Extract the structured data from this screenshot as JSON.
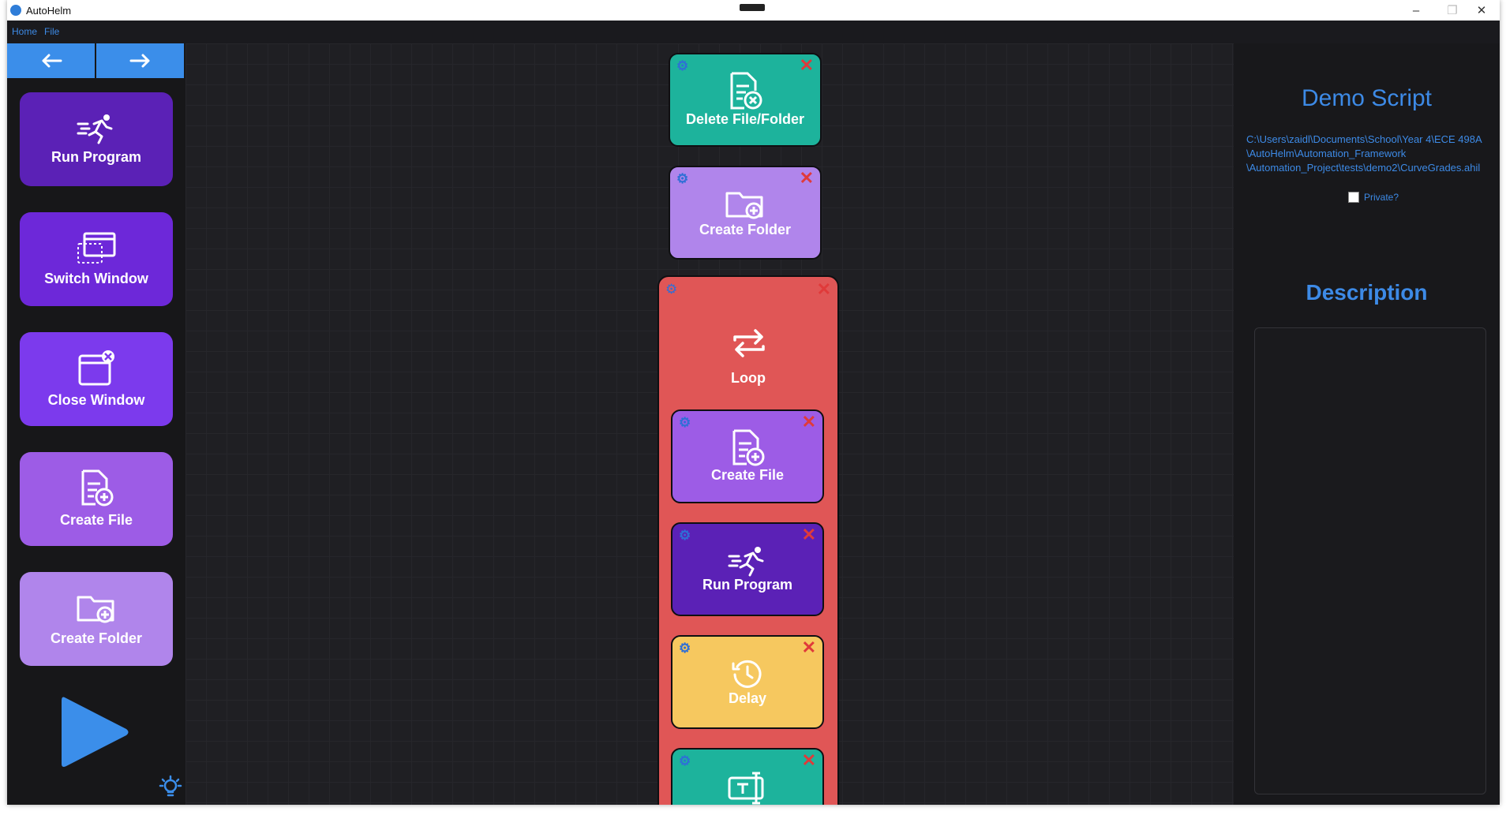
{
  "window": {
    "title": "AutoHelm",
    "minimize_icon": "minimize-icon",
    "maximize_icon": "maximize-icon",
    "close_icon": "close-icon"
  },
  "menu": {
    "home": "Home",
    "file": "File"
  },
  "nav": {
    "back_icon": "arrow-left-icon",
    "forward_icon": "arrow-right-icon"
  },
  "palette": {
    "items": [
      {
        "label": "Run Program",
        "icon": "running-person-icon",
        "color": "#5b21b6"
      },
      {
        "label": "Switch Window",
        "icon": "switch-window-icon",
        "color": "#6d28d9"
      },
      {
        "label": "Close Window",
        "icon": "close-window-icon",
        "color": "#7c3aed"
      },
      {
        "label": "Create File",
        "icon": "create-file-icon",
        "color": "#9d5ce6"
      },
      {
        "label": "Create Folder",
        "icon": "create-folder-icon",
        "color": "#b085eb"
      }
    ],
    "run_icon": "play-icon",
    "theme_icon": "lightbulb-icon"
  },
  "canvas": {
    "blocks": [
      {
        "label": "Delete File/Folder",
        "icon": "delete-file-icon",
        "color": "#1db39c"
      },
      {
        "label": "Create Folder",
        "icon": "create-folder-icon",
        "color": "#b085eb"
      },
      {
        "label": "Loop",
        "icon": "loop-icon",
        "color": "#e05656"
      },
      {
        "label": "Create File",
        "icon": "create-file-icon",
        "color": "#9d5ce6"
      },
      {
        "label": "Run Program",
        "icon": "running-person-icon",
        "color": "#5b21b6"
      },
      {
        "label": "Delay",
        "icon": "clock-icon",
        "color": "#f6c85f"
      },
      {
        "label": "",
        "icon": "text-input-icon",
        "color": "#1db39c"
      }
    ]
  },
  "panel": {
    "script_title": "Demo Script",
    "script_path": "C:\\Users\\zaidl\\Documents\\School\\Year 4\\ECE 498A\n\\AutoHelm\\Automation_Framework\n\\Automation_Project\\tests\\demo2\\CurveGrades.ahil",
    "private_label": "Private?",
    "private_checked": false,
    "description_title": "Description",
    "description_text": ""
  }
}
